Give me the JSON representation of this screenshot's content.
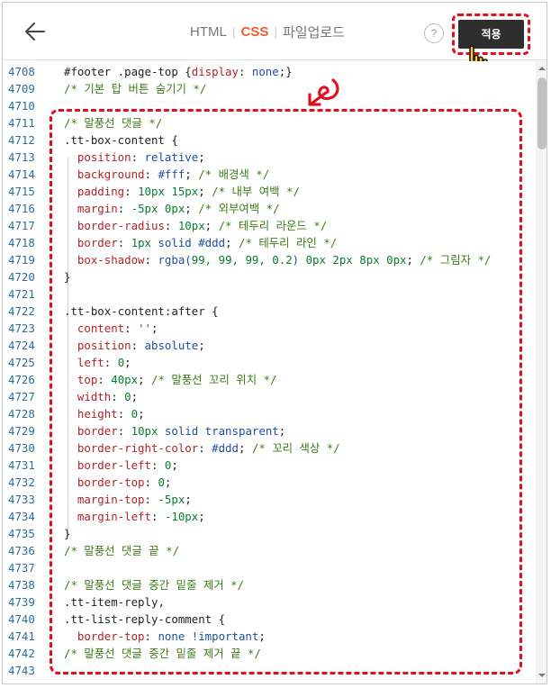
{
  "topbar": {
    "tabs": [
      {
        "label": "HTML",
        "active": false
      },
      {
        "label": "CSS",
        "active": true
      },
      {
        "label": "파일업로드",
        "active": false
      }
    ],
    "help_label": "?",
    "apply_label": "적용"
  },
  "icons": [
    "back-arrow-icon",
    "help-icon",
    "pointing-hand-icon",
    "scroll-up-icon",
    "scroll-down-icon"
  ],
  "colors": {
    "accent": "#ef5b2c",
    "annotation": "#e0101f",
    "apply_bg": "#2e2e2e"
  },
  "editor": {
    "lines": [
      {
        "n": "4708",
        "tokens": [
          [
            "sel",
            "#footer .page-top "
          ],
          [
            "pun",
            "{"
          ],
          [
            "prop",
            "display"
          ],
          [
            "pun",
            ": "
          ],
          [
            "val",
            "none"
          ],
          [
            "pun",
            ";}"
          ]
        ]
      },
      {
        "n": "4709",
        "tokens": [
          [
            "com",
            "/* 기본 탑 버튼 숨기기 */"
          ]
        ]
      },
      {
        "n": "4710",
        "tokens": []
      },
      {
        "n": "4711",
        "tokens": [
          [
            "com",
            "/* 말풍선 댓글 */"
          ]
        ]
      },
      {
        "n": "4712",
        "tokens": [
          [
            "sel",
            ".tt-box-content "
          ],
          [
            "pun",
            "{"
          ]
        ]
      },
      {
        "n": "4713",
        "tokens": [
          [
            "sp",
            "  "
          ],
          [
            "prop",
            "position"
          ],
          [
            "pun",
            ": "
          ],
          [
            "val",
            "relative"
          ],
          [
            "pun",
            ";"
          ]
        ]
      },
      {
        "n": "4714",
        "tokens": [
          [
            "sp",
            "  "
          ],
          [
            "prop",
            "background"
          ],
          [
            "pun",
            ": "
          ],
          [
            "val",
            "#fff"
          ],
          [
            "pun",
            "; "
          ],
          [
            "com",
            "/* 배경색 */"
          ]
        ]
      },
      {
        "n": "4715",
        "tokens": [
          [
            "sp",
            "  "
          ],
          [
            "prop",
            "padding"
          ],
          [
            "pun",
            ": "
          ],
          [
            "num",
            "10px 15px"
          ],
          [
            "pun",
            "; "
          ],
          [
            "com",
            "/* 내부 여백 */"
          ]
        ]
      },
      {
        "n": "4716",
        "tokens": [
          [
            "sp",
            "  "
          ],
          [
            "prop",
            "margin"
          ],
          [
            "pun",
            ": "
          ],
          [
            "num",
            "-5px 0px"
          ],
          [
            "pun",
            "; "
          ],
          [
            "com",
            "/* 외부여백 */"
          ]
        ]
      },
      {
        "n": "4717",
        "tokens": [
          [
            "sp",
            "  "
          ],
          [
            "prop",
            "border-radius"
          ],
          [
            "pun",
            ": "
          ],
          [
            "num",
            "10px"
          ],
          [
            "pun",
            "; "
          ],
          [
            "com",
            "/* 테두리 라운드 */"
          ]
        ]
      },
      {
        "n": "4718",
        "tokens": [
          [
            "sp",
            "  "
          ],
          [
            "prop",
            "border"
          ],
          [
            "pun",
            ": "
          ],
          [
            "num",
            "1px "
          ],
          [
            "val",
            "solid #ddd"
          ],
          [
            "pun",
            "; "
          ],
          [
            "com",
            "/* 테두리 라인 */"
          ]
        ]
      },
      {
        "n": "4719",
        "tokens": [
          [
            "sp",
            "  "
          ],
          [
            "prop",
            "box-shadow"
          ],
          [
            "pun",
            ": "
          ],
          [
            "val",
            "rgba("
          ],
          [
            "num",
            "99, 99, 99, 0.2"
          ],
          [
            "val",
            ") "
          ],
          [
            "num",
            "0px 2px 8px 0px"
          ],
          [
            "pun",
            "; "
          ],
          [
            "com",
            "/* 그림자 */"
          ]
        ]
      },
      {
        "n": "4720",
        "tokens": [
          [
            "pun",
            "}"
          ]
        ]
      },
      {
        "n": "4721",
        "tokens": []
      },
      {
        "n": "4722",
        "tokens": [
          [
            "sel",
            ".tt-box-content:after "
          ],
          [
            "pun",
            "{"
          ]
        ]
      },
      {
        "n": "4723",
        "tokens": [
          [
            "sp",
            "  "
          ],
          [
            "prop",
            "content"
          ],
          [
            "pun",
            ": "
          ],
          [
            "str",
            "''"
          ],
          [
            "pun",
            ";"
          ]
        ]
      },
      {
        "n": "4724",
        "tokens": [
          [
            "sp",
            "  "
          ],
          [
            "prop",
            "position"
          ],
          [
            "pun",
            ": "
          ],
          [
            "val",
            "absolute"
          ],
          [
            "pun",
            ";"
          ]
        ]
      },
      {
        "n": "4725",
        "tokens": [
          [
            "sp",
            "  "
          ],
          [
            "prop",
            "left"
          ],
          [
            "pun",
            ": "
          ],
          [
            "num",
            "0"
          ],
          [
            "pun",
            ";"
          ]
        ]
      },
      {
        "n": "4726",
        "tokens": [
          [
            "sp",
            "  "
          ],
          [
            "prop",
            "top"
          ],
          [
            "pun",
            ": "
          ],
          [
            "num",
            "40px"
          ],
          [
            "pun",
            "; "
          ],
          [
            "com",
            "/* 말풍선 꼬리 위치 */"
          ]
        ]
      },
      {
        "n": "4727",
        "tokens": [
          [
            "sp",
            "  "
          ],
          [
            "prop",
            "width"
          ],
          [
            "pun",
            ": "
          ],
          [
            "num",
            "0"
          ],
          [
            "pun",
            ";"
          ]
        ]
      },
      {
        "n": "4728",
        "tokens": [
          [
            "sp",
            "  "
          ],
          [
            "prop",
            "height"
          ],
          [
            "pun",
            ": "
          ],
          [
            "num",
            "0"
          ],
          [
            "pun",
            ";"
          ]
        ]
      },
      {
        "n": "4729",
        "tokens": [
          [
            "sp",
            "  "
          ],
          [
            "prop",
            "border"
          ],
          [
            "pun",
            ": "
          ],
          [
            "num",
            "10px "
          ],
          [
            "val",
            "solid transparent"
          ],
          [
            "pun",
            ";"
          ]
        ]
      },
      {
        "n": "4730",
        "tokens": [
          [
            "sp",
            "  "
          ],
          [
            "prop",
            "border-right-color"
          ],
          [
            "pun",
            ": "
          ],
          [
            "val",
            "#ddd"
          ],
          [
            "pun",
            "; "
          ],
          [
            "com",
            "/* 꼬리 색상 */"
          ]
        ]
      },
      {
        "n": "4731",
        "tokens": [
          [
            "sp",
            "  "
          ],
          [
            "prop",
            "border-left"
          ],
          [
            "pun",
            ": "
          ],
          [
            "num",
            "0"
          ],
          [
            "pun",
            ";"
          ]
        ]
      },
      {
        "n": "4732",
        "tokens": [
          [
            "sp",
            "  "
          ],
          [
            "prop",
            "border-top"
          ],
          [
            "pun",
            ": "
          ],
          [
            "num",
            "0"
          ],
          [
            "pun",
            ";"
          ]
        ]
      },
      {
        "n": "4733",
        "tokens": [
          [
            "sp",
            "  "
          ],
          [
            "prop",
            "margin-top"
          ],
          [
            "pun",
            ": "
          ],
          [
            "num",
            "-5px"
          ],
          [
            "pun",
            ";"
          ]
        ]
      },
      {
        "n": "4734",
        "tokens": [
          [
            "sp",
            "  "
          ],
          [
            "prop",
            "margin-left"
          ],
          [
            "pun",
            ": "
          ],
          [
            "num",
            "-10px"
          ],
          [
            "pun",
            ";"
          ]
        ]
      },
      {
        "n": "4735",
        "tokens": [
          [
            "pun",
            "}"
          ]
        ]
      },
      {
        "n": "4736",
        "tokens": [
          [
            "com",
            "/* 말풍선 댓글 끝 */"
          ]
        ]
      },
      {
        "n": "4737",
        "tokens": []
      },
      {
        "n": "4738",
        "tokens": [
          [
            "com",
            "/* 말풍선 댓글 중간 밑줄 제거 */"
          ]
        ]
      },
      {
        "n": "4739",
        "tokens": [
          [
            "sel",
            ".tt-item-reply"
          ],
          [
            "pun",
            ","
          ]
        ]
      },
      {
        "n": "4740",
        "tokens": [
          [
            "sel",
            ".tt-list-reply-comment "
          ],
          [
            "pun",
            "{"
          ]
        ]
      },
      {
        "n": "4741",
        "tokens": [
          [
            "sp",
            "  "
          ],
          [
            "prop",
            "border-top"
          ],
          [
            "pun",
            ": "
          ],
          [
            "val",
            "none !important"
          ],
          [
            "pun",
            ";"
          ]
        ]
      },
      {
        "n": "4742",
        "tokens": [
          [
            "com",
            "/* 말풍선 댓글 중간 밑줄 제거 끝 */"
          ]
        ]
      },
      {
        "n": "4743",
        "tokens": []
      }
    ]
  }
}
